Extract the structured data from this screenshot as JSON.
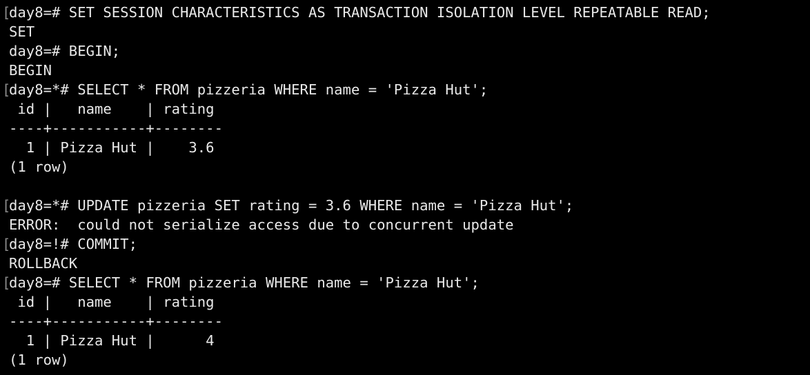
{
  "terminal": {
    "lines": [
      {
        "bracket": true,
        "text": "day8=# SET SESSION CHARACTERISTICS AS TRANSACTION ISOLATION LEVEL REPEATABLE READ;"
      },
      {
        "bracket": false,
        "text": "SET"
      },
      {
        "bracket": false,
        "text": "day8=# BEGIN;"
      },
      {
        "bracket": false,
        "text": "BEGIN"
      },
      {
        "bracket": true,
        "text": "day8=*# SELECT * FROM pizzeria WHERE name = 'Pizza Hut';"
      },
      {
        "bracket": false,
        "text": " id |   name    | rating"
      },
      {
        "bracket": false,
        "text": "----+-----------+--------"
      },
      {
        "bracket": false,
        "text": "  1 | Pizza Hut |    3.6"
      },
      {
        "bracket": false,
        "text": "(1 row)"
      },
      {
        "bracket": false,
        "text": ""
      },
      {
        "bracket": true,
        "text": "day8=*# UPDATE pizzeria SET rating = 3.6 WHERE name = 'Pizza Hut';"
      },
      {
        "bracket": false,
        "text": "ERROR:  could not serialize access due to concurrent update"
      },
      {
        "bracket": true,
        "text": "day8=!# COMMIT;"
      },
      {
        "bracket": false,
        "text": "ROLLBACK"
      },
      {
        "bracket": true,
        "text": "day8=# SELECT * FROM pizzeria WHERE name = 'Pizza Hut';"
      },
      {
        "bracket": false,
        "text": " id |   name    | rating"
      },
      {
        "bracket": false,
        "text": "----+-----------+--------"
      },
      {
        "bracket": false,
        "text": "  1 | Pizza Hut |      4"
      },
      {
        "bracket": false,
        "text": "(1 row)"
      }
    ],
    "colors": {
      "background": "#000000",
      "foreground": "#e8e8e8",
      "bracket": "#8a8a8a"
    }
  }
}
